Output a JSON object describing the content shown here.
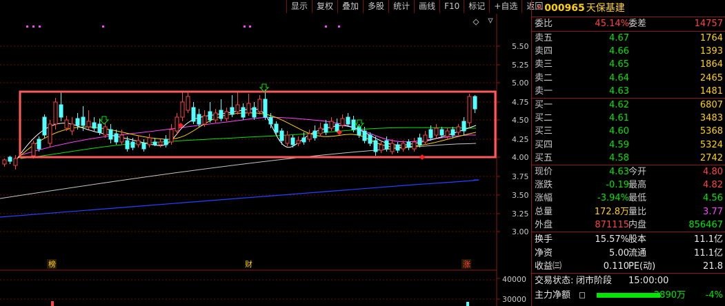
{
  "toolbar": {
    "items": [
      "显示",
      "复权",
      "叠加",
      "多股",
      "统计",
      "画线",
      "F10",
      "标记",
      "+自选",
      "返回"
    ]
  },
  "chart": {
    "price_axis": [
      "5.50",
      "5.25",
      "5.00",
      "4.75",
      "4.50",
      "4.25",
      "4.00",
      "3.75",
      "3.50",
      "3.25",
      "3.00"
    ],
    "volume_axis": [
      "40000",
      "30000"
    ],
    "event_markers": {
      "left": "榜",
      "middle": "财",
      "right": "涨"
    },
    "colors": {
      "up": "#ff4444",
      "down": "#54ffff",
      "ma5": "#ffffff",
      "ma10": "#ffd200",
      "ma20": "#ff44ff",
      "ma60": "#00e600",
      "ma120": "#c8c8c8",
      "ma250": "#2244ff",
      "highlight_box": "#ff5a5a"
    }
  },
  "quote": {
    "r_mark": "R",
    "code": "000965",
    "name": "天保基建",
    "weibi_label": "委比",
    "weibi_value": "45.14%",
    "weicha_label": "委差",
    "weicha_value": "14757",
    "asks": [
      {
        "label": "卖五",
        "price": "4.67",
        "vol": "1764"
      },
      {
        "label": "卖四",
        "price": "4.66",
        "vol": "1393"
      },
      {
        "label": "卖三",
        "price": "4.65",
        "vol": "1864"
      },
      {
        "label": "卖二",
        "price": "4.64",
        "vol": "2465"
      },
      {
        "label": "卖一",
        "price": "4.63",
        "vol": "1481"
      }
    ],
    "bids": [
      {
        "label": "买一",
        "price": "4.62",
        "vol": "6807"
      },
      {
        "label": "买二",
        "price": "4.61",
        "vol": "3483"
      },
      {
        "label": "买三",
        "price": "4.60",
        "vol": "5368"
      },
      {
        "label": "买四",
        "price": "4.59",
        "vol": "5324"
      },
      {
        "label": "买五",
        "price": "4.58",
        "vol": "2742"
      }
    ],
    "stats": [
      {
        "l1": "现价",
        "v1": "4.63",
        "l2": "今开",
        "v2": "4.80"
      },
      {
        "l1": "涨跌",
        "v1": "-0.19",
        "l2": "最高",
        "v2": "4.82"
      },
      {
        "l1": "涨幅",
        "v1": "-3.94%",
        "l2": "最低",
        "v2": "4.56"
      },
      {
        "l1": "总量",
        "v1": "172.8万",
        "l2": "量比",
        "v2": "3.77"
      },
      {
        "l1": "外盘",
        "v1": "871115",
        "l2": "内盘",
        "v2": "856467"
      }
    ],
    "fundamentals": [
      {
        "l1": "换手",
        "v1": "15.57%",
        "l2": "股本",
        "v2": "11.1亿"
      },
      {
        "l1": "净资",
        "v1": "5.00",
        "l2": "流通",
        "v2": "11.1亿"
      },
      {
        "l1": "收益㈢",
        "v1": "0.110",
        "l2": "PE(动)",
        "v2": "21.8"
      }
    ],
    "trade_status_label": "交易状态:",
    "trade_status_value": "闭市阶段",
    "trade_time": "15:00:00",
    "main_net_label": "主力净额",
    "main_net_value": "-2890万",
    "main_net_pct": "-4%"
  }
}
